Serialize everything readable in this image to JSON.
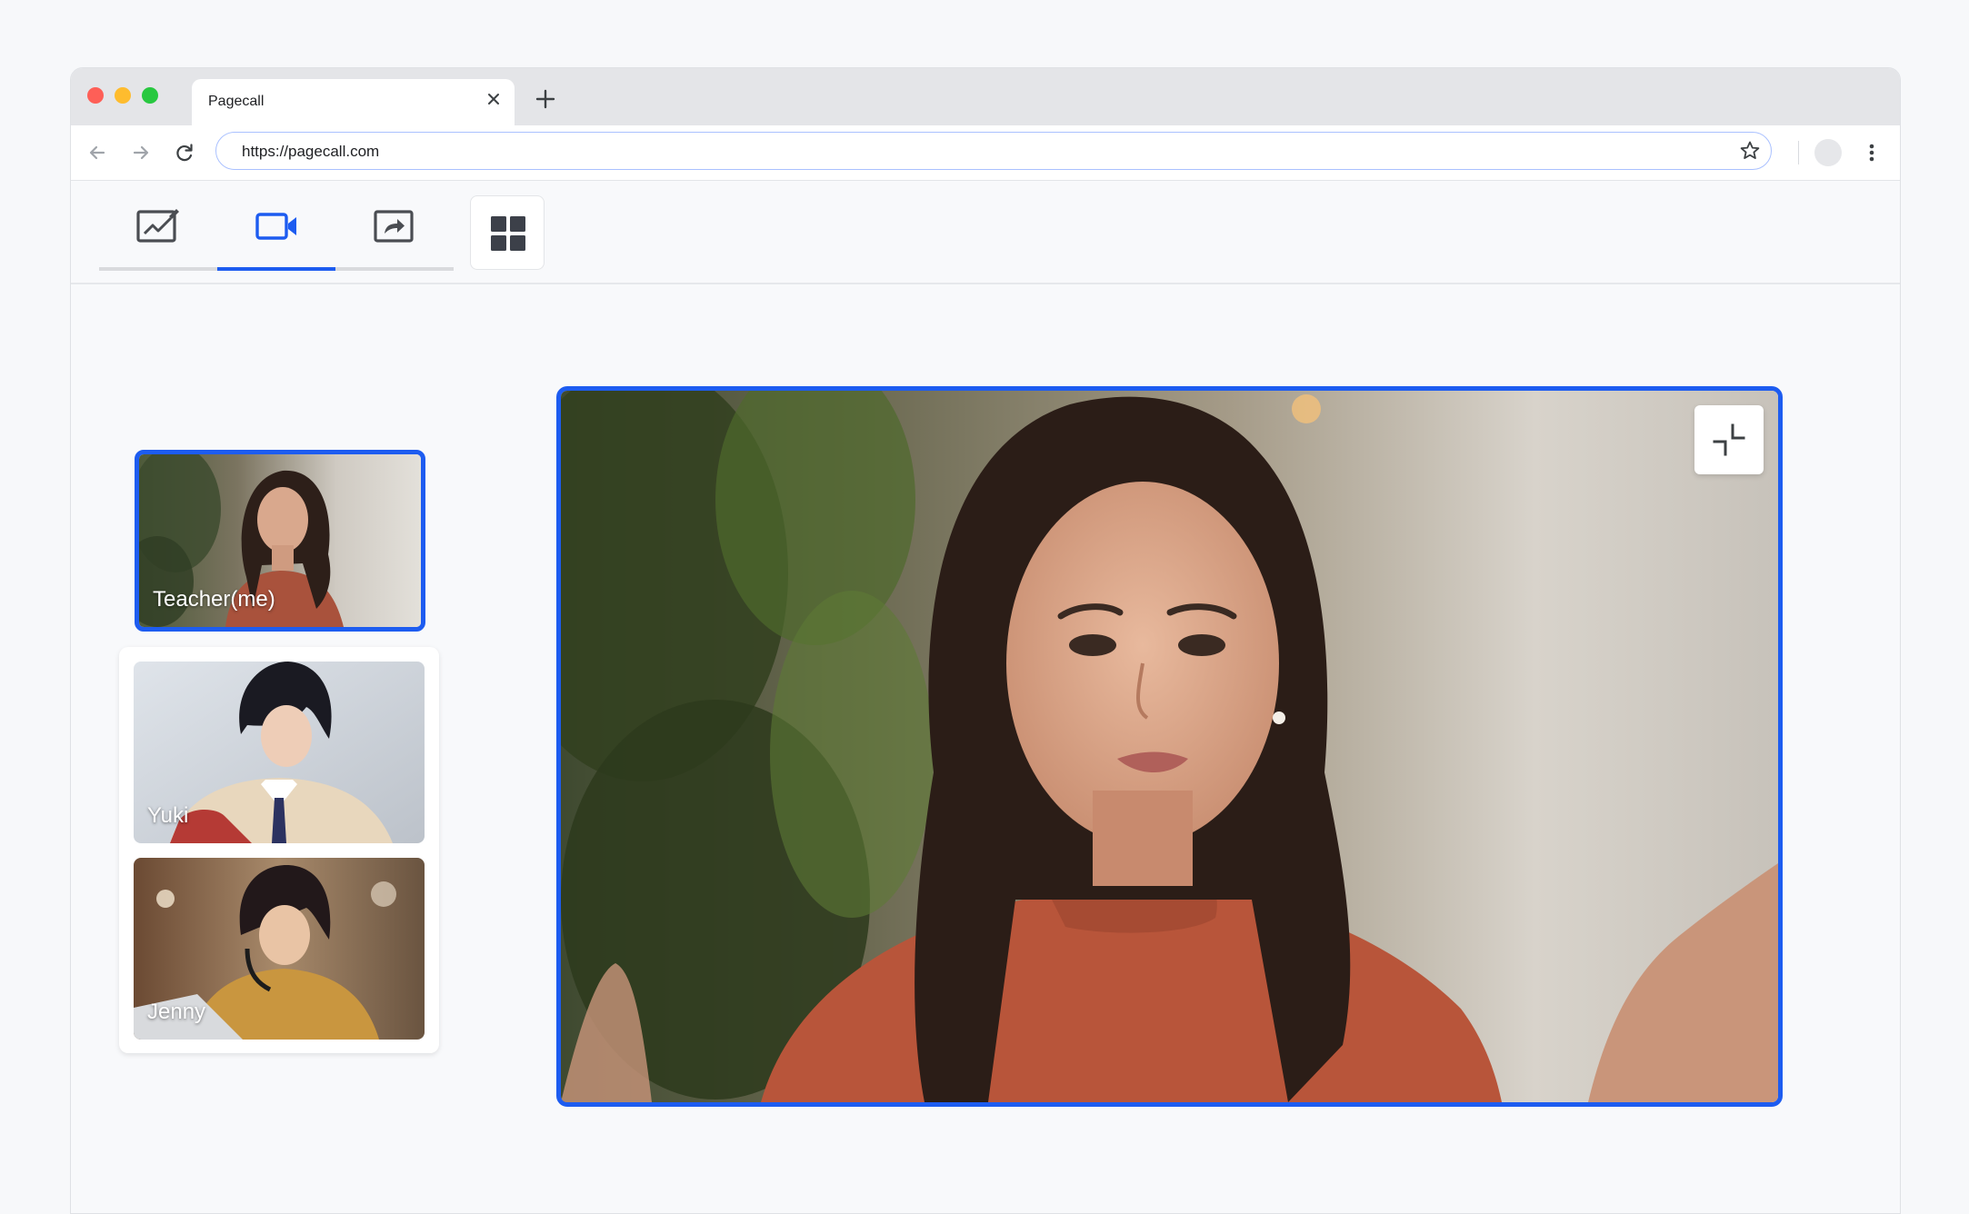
{
  "browser": {
    "tab_title": "Pagecall",
    "url": "https://pagecall.com"
  },
  "icons": {
    "close": "close-icon",
    "new_tab": "plus-icon",
    "back": "arrow-left-icon",
    "forward": "arrow-right-icon",
    "reload": "reload-icon",
    "bookmark": "star-icon",
    "menu": "kebab-menu-icon",
    "whiteboard": "whiteboard-icon",
    "video": "video-camera-icon",
    "screenshare": "screen-share-icon",
    "layout": "grid-layout-icon",
    "shrink": "shrink-icon"
  },
  "app": {
    "active_mode": "video",
    "participants": [
      {
        "name": "Teacher(me)",
        "selected": true
      },
      {
        "name": "Yuki",
        "selected": false
      },
      {
        "name": "Jenny",
        "selected": false
      }
    ]
  },
  "colors": {
    "accent": "#1d5cf0",
    "icon_gray": "#4a4d52",
    "traffic_red": "#fe5f57",
    "traffic_yellow": "#febc2e",
    "traffic_green": "#28c840"
  }
}
